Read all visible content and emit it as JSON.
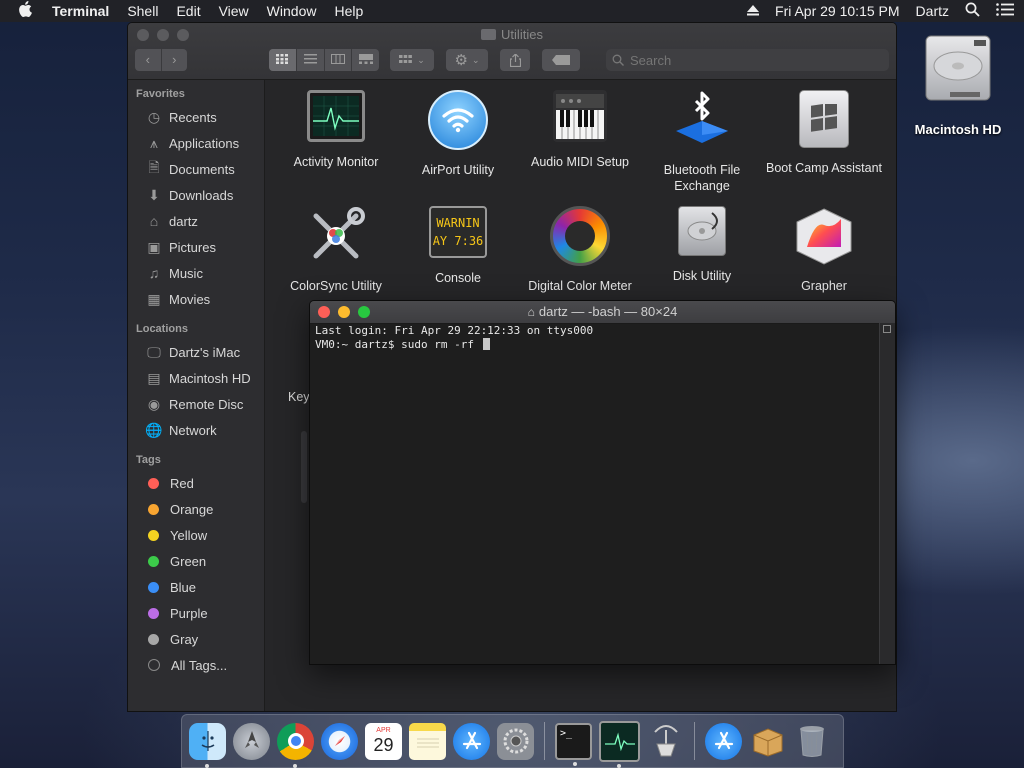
{
  "menubar": {
    "apple_icon": "apple-logo-icon",
    "app_name": "Terminal",
    "menus": [
      "Shell",
      "Edit",
      "View",
      "Window",
      "Help"
    ],
    "datetime": "Fri Apr 29  10:15 PM",
    "user": "Dartz"
  },
  "desktop": {
    "drive_label": "Macintosh HD"
  },
  "finder": {
    "title": "Utilities",
    "search_placeholder": "Search",
    "sidebar": {
      "favorites_heading": "Favorites",
      "favorites": [
        {
          "label": "Recents",
          "icon": "clock-icon"
        },
        {
          "label": "Applications",
          "icon": "applications-icon"
        },
        {
          "label": "Documents",
          "icon": "document-icon"
        },
        {
          "label": "Downloads",
          "icon": "download-icon"
        },
        {
          "label": "dartz",
          "icon": "home-icon"
        },
        {
          "label": "Pictures",
          "icon": "camera-icon"
        },
        {
          "label": "Music",
          "icon": "music-note-icon"
        },
        {
          "label": "Movies",
          "icon": "film-icon"
        }
      ],
      "locations_heading": "Locations",
      "locations": [
        {
          "label": "Dartz's iMac",
          "icon": "imac-icon"
        },
        {
          "label": "Macintosh HD",
          "icon": "hard-drive-icon"
        },
        {
          "label": "Remote Disc",
          "icon": "disc-icon"
        },
        {
          "label": "Network",
          "icon": "globe-icon"
        }
      ],
      "tags_heading": "Tags",
      "tags": [
        {
          "label": "Red",
          "color": "#ff5f57"
        },
        {
          "label": "Orange",
          "color": "#f8a531"
        },
        {
          "label": "Yellow",
          "color": "#f3d321"
        },
        {
          "label": "Green",
          "color": "#3ccb4a"
        },
        {
          "label": "Blue",
          "color": "#3a8ef6"
        },
        {
          "label": "Purple",
          "color": "#bc6de6"
        },
        {
          "label": "Gray",
          "color": "#a7a7a7"
        }
      ],
      "all_tags": "All Tags..."
    },
    "apps": [
      {
        "label": "Activity Monitor"
      },
      {
        "label": "AirPort Utility"
      },
      {
        "label": "Audio MIDI Setup"
      },
      {
        "label": "Bluetooth File Exchange"
      },
      {
        "label": "Boot Camp Assistant"
      },
      {
        "label": "ColorSync Utility"
      },
      {
        "label": "Console",
        "icon_text_line1": "WARNIN",
        "icon_text_line2": "AY 7:36"
      },
      {
        "label": "Digital Color Meter"
      },
      {
        "label": "Disk Utility"
      },
      {
        "label": "Grapher"
      }
    ],
    "partial_label": "Key"
  },
  "terminal": {
    "title": "dartz — -bash — 80×24",
    "lines": [
      "Last login: Fri Apr 29 22:12:33 on ttys000",
      "VM0:~ dartz$ sudo rm -rf "
    ]
  },
  "dock": {
    "calendar_month": "APR",
    "calendar_day": "29",
    "items": [
      "finder-icon",
      "launchpad-icon",
      "chrome-icon",
      "safari-icon",
      "calendar-icon",
      "notes-icon",
      "app-store-icon",
      "system-preferences-icon",
      "terminal-icon",
      "activity-monitor-icon",
      "network-utility-icon",
      "downloads-stack-icon",
      "archive-icon",
      "trash-icon"
    ]
  }
}
